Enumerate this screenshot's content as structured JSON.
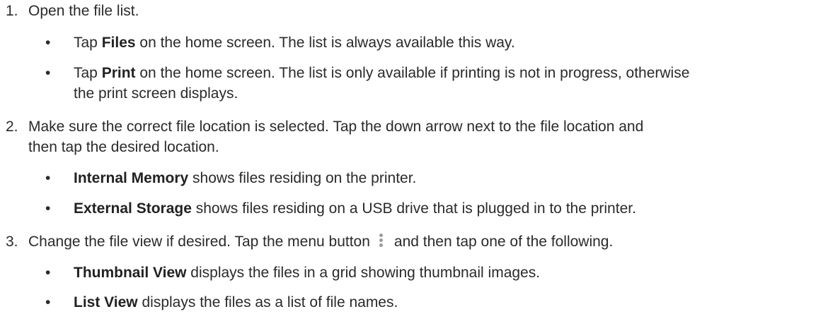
{
  "steps": [
    {
      "number": "1.",
      "text": "Open the file list.",
      "bullets": [
        {
          "pre": "Tap ",
          "bold": "Files",
          "post": " on the home screen. The list is always available this way."
        },
        {
          "pre": "Tap ",
          "bold": "Print",
          "post": " on the home screen. The list is only available if printing is not in progress, otherwise",
          "cont": "the print screen displays."
        }
      ]
    },
    {
      "number": "2.",
      "text": "Make sure the correct file location is selected. Tap the down arrow next to the file location and",
      "cont": "then tap the desired location.",
      "bullets": [
        {
          "bold": "Internal Memory",
          "post": " shows files residing on the printer."
        },
        {
          "bold": "External Storage",
          "post": " shows files residing on a USB drive that is plugged in to the printer."
        }
      ]
    },
    {
      "number": "3.",
      "text_pre": "Change the file view if desired. Tap the menu button",
      "menu_icon": "vertical-ellipsis-menu-icon",
      "text_post": "and then tap one of the following.",
      "bullets": [
        {
          "bold": "Thumbnail View",
          "post": " displays the files in a grid showing thumbnail images."
        },
        {
          "bold": "List View",
          "post": " displays the files as a list of file names."
        }
      ]
    }
  ],
  "bullet_char": "•"
}
